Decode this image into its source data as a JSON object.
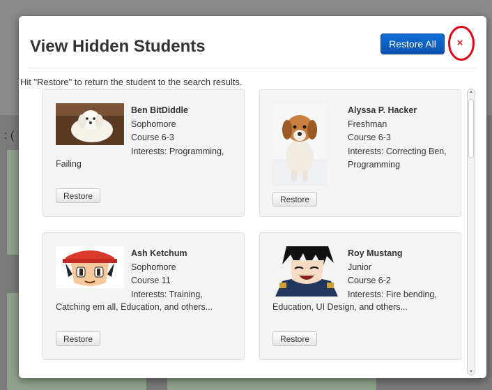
{
  "modal": {
    "title": "View Hidden Students",
    "restore_all_label": "Restore All",
    "close_label": "×",
    "hint": "Hit \"Restore\" to return the student to the search results."
  },
  "background": {
    "fragment": ": ("
  },
  "students": [
    {
      "name": "Ben BitDiddle",
      "year": "Sophomore",
      "course": "Course 6-3",
      "interests_line1": "Interests: Programming,",
      "interests_line2": "Failing",
      "restore_label": "Restore",
      "photo_icon": "white-puppy-photo"
    },
    {
      "name": "Alyssa P. Hacker",
      "year": "Freshman",
      "course": "Course 6-3",
      "interests_line1": "Interests: Correcting Ben,",
      "interests_line2": "Programming",
      "restore_label": "Restore",
      "photo_icon": "brown-puppy-photo"
    },
    {
      "name": "Ash Ketchum",
      "year": "Sophomore",
      "course": "Course 11",
      "interests_line1": "Interests: Training,",
      "interests_line2": "Catching em all, Education, and others...",
      "restore_label": "Restore",
      "photo_icon": "cartoon-boy-cap-photo"
    },
    {
      "name": "Roy Mustang",
      "year": "Junior",
      "course": "Course 6-2",
      "interests_line1": "Interests: Fire bending,",
      "interests_line2": "Education, UI Design, and others...",
      "restore_label": "Restore",
      "photo_icon": "cartoon-officer-photo"
    }
  ],
  "colors": {
    "primary": "#0a52b0",
    "close": "#d22222",
    "highlight_ring": "#e00015",
    "card_bg": "#f4f4f4"
  }
}
